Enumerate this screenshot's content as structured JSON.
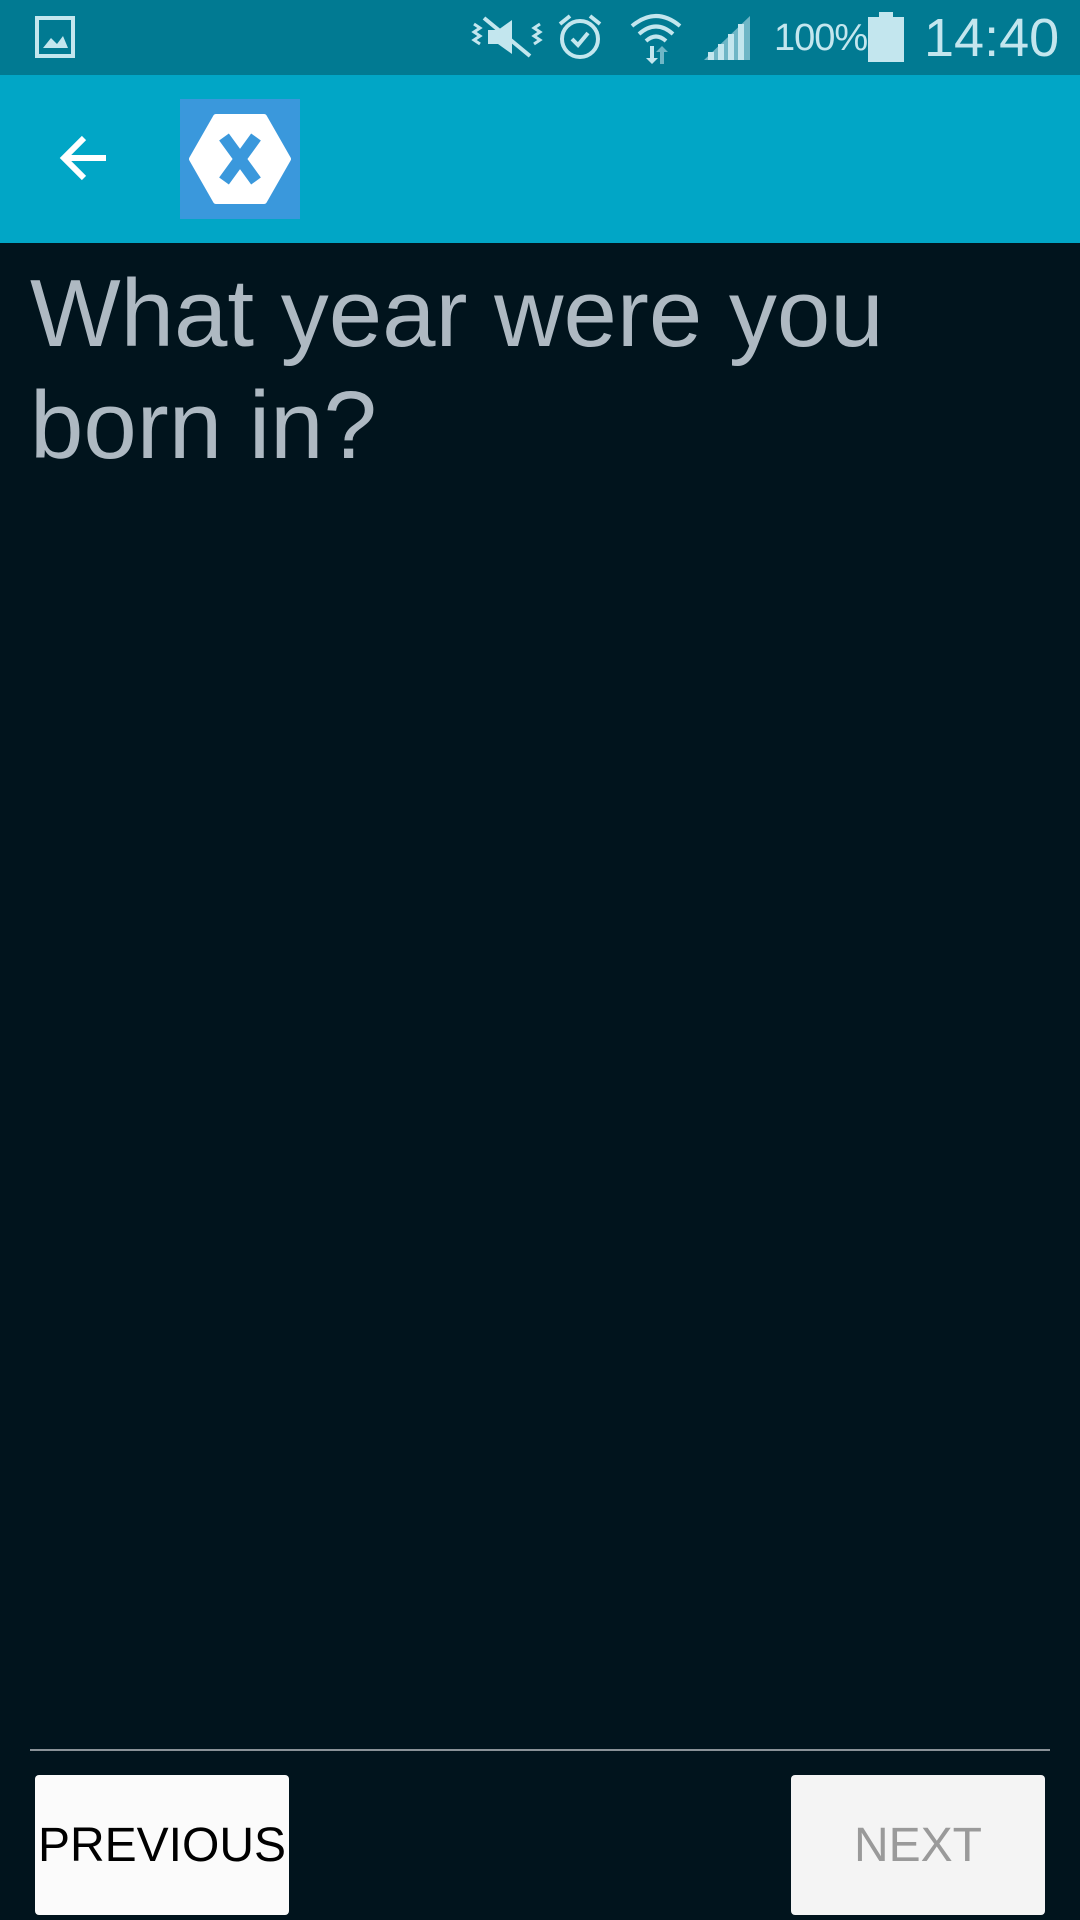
{
  "status_bar": {
    "battery_percent": "100%",
    "time": "14:40",
    "icons": [
      "gallery-notification-icon",
      "mute-vibrate-icon",
      "alarm-icon",
      "wifi-icon",
      "signal-icon",
      "battery-icon"
    ]
  },
  "app_bar": {
    "back_icon": "arrow-back-icon",
    "logo_icon": "xamarin-logo-icon",
    "colors": {
      "background": "#01a6c6",
      "logo_background": "#3a98dc"
    }
  },
  "question": {
    "text": "What year were you born in?"
  },
  "buttons": {
    "previous_label": "PREVIOUS",
    "next_label": "NEXT",
    "next_enabled": false
  },
  "colors": {
    "page_background": "#01141d",
    "status_bar": "#017a92",
    "question_text": "#aeb9c2"
  }
}
